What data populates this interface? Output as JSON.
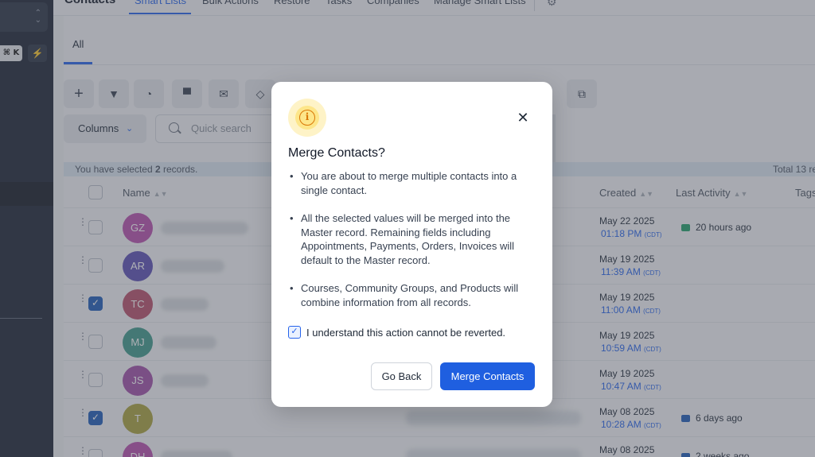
{
  "sidebar": {
    "shortcut": "⌘ K"
  },
  "topnav": {
    "title": "Contacts",
    "items": [
      "Smart Lists",
      "Bulk Actions",
      "Restore",
      "Tasks",
      "Companies",
      "Manage Smart Lists"
    ]
  },
  "tabs": {
    "all": "All"
  },
  "toolbar": {
    "columns_label": "Columns",
    "search_placeholder": "Quick search"
  },
  "selection": {
    "prefix": "You have selected",
    "count": "2",
    "suffix": "records.",
    "total": "Total 13 re"
  },
  "table": {
    "headers": {
      "name": "Name",
      "created": "Created",
      "last_activity": "Last Activity",
      "tags": "Tags"
    },
    "rows": [
      {
        "initials": "GZ",
        "color": "#b84fae",
        "checked": false,
        "date": "May 22 2025",
        "time": "01:18 PM",
        "tz": "(CDT)",
        "activity": "20 hours ago",
        "activity_icon": "chat-icon"
      },
      {
        "initials": "AR",
        "color": "#5b4fb5",
        "checked": false,
        "date": "May 19 2025",
        "time": "11:39 AM",
        "tz": "(CDT)",
        "activity": "",
        "activity_icon": ""
      },
      {
        "initials": "TC",
        "color": "#b84f6a",
        "checked": true,
        "date": "May 19 2025",
        "time": "11:00 AM",
        "tz": "(CDT)",
        "activity": "",
        "activity_icon": ""
      },
      {
        "initials": "MJ",
        "color": "#3f9a8a",
        "checked": false,
        "date": "May 19 2025",
        "time": "10:59 AM",
        "tz": "(CDT)",
        "activity": "",
        "activity_icon": ""
      },
      {
        "initials": "JS",
        "color": "#a04fa8",
        "checked": false,
        "date": "May 19 2025",
        "time": "10:47 AM",
        "tz": "(CDT)",
        "activity": "",
        "activity_icon": ""
      },
      {
        "initials": "T",
        "color": "#a9a23d",
        "checked": true,
        "date": "May 08 2025",
        "time": "10:28 AM",
        "tz": "(CDT)",
        "activity": "6 days ago",
        "activity_icon": "email-icon"
      },
      {
        "initials": "DH",
        "color": "#b84fae",
        "checked": false,
        "date": "May 08 2025",
        "time": "",
        "tz": "",
        "activity": "2 weeks ago",
        "activity_icon": "email-icon"
      }
    ]
  },
  "modal": {
    "title": "Merge Contacts?",
    "bullets": [
      "You are about to merge multiple contacts into a single contact.",
      "All the selected values will be merged into the Master record. Remaining fields including Appointments, Payments, Orders, Invoices will default to the Master record.",
      "Courses, Community Groups, and Products will combine information from all records."
    ],
    "confirm_label": "I understand this action cannot be reverted.",
    "confirm_checked": true,
    "go_back_label": "Go Back",
    "merge_label": "Merge Contacts"
  },
  "colors": {
    "primary": "#1f5fe0",
    "warning": "#d97706",
    "sidebar": "#1c2333"
  }
}
